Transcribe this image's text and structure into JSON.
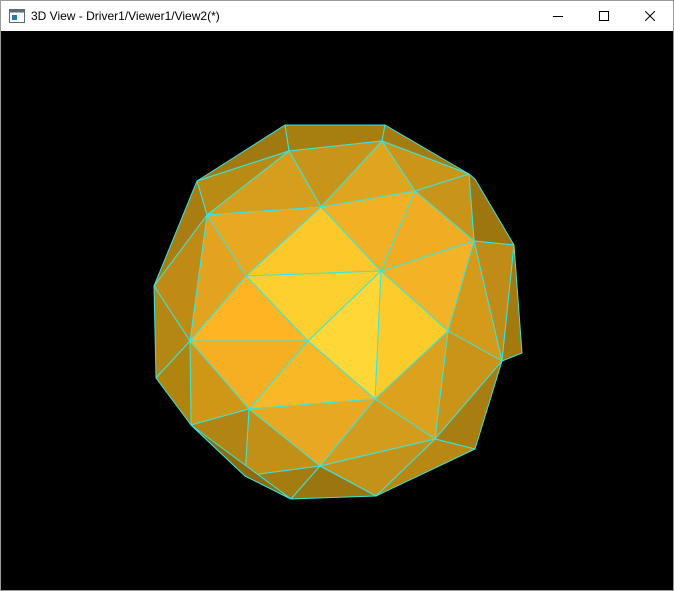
{
  "window": {
    "title": "3D View - Driver1/Viewer1/View2(*)",
    "controls": {
      "minimize_icon": "minimize-icon",
      "maximize_icon": "maximize-icon",
      "close_icon": "close-icon"
    }
  },
  "viewport": {
    "background": "#000000",
    "edge_color": "#33e8e0",
    "shape": "polyhedron"
  }
}
